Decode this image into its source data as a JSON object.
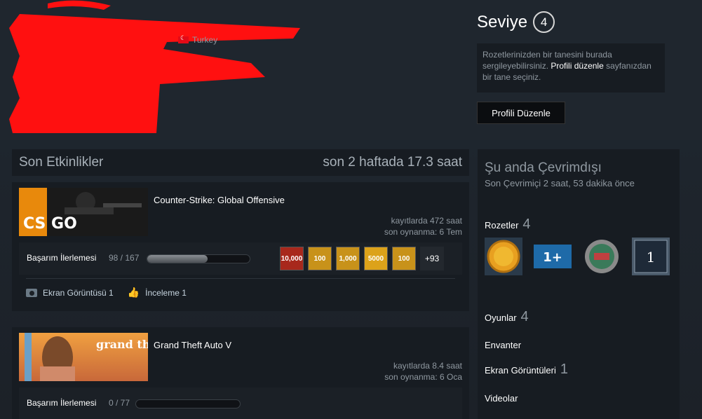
{
  "header": {
    "country": "Turkey",
    "level_label": "Seviye",
    "level_value": "4",
    "badge_hint_pre": "Rozetlerinizden bir tanesini burada sergileyebilirsiniz.",
    "badge_hint_link": "Profili düzenle",
    "badge_hint_post": "sayfanızdan bir tane seçiniz.",
    "edit_button": "Profili Düzenle"
  },
  "recent": {
    "title": "Son Etkinlikler",
    "hours": "son 2 haftada 17.3 saat",
    "games": [
      {
        "name": "Counter-Strike: Global Offensive",
        "hours_on_record": "kayıtlarda 472 saat",
        "last_played": "son oynanma: 6 Tem",
        "ach_label": "Başarım İlerlemesi",
        "ach_count": "98 / 167",
        "ach_progress": 0.587,
        "ach_icons": [
          "10,000",
          "100",
          "1,000",
          "5000",
          "100"
        ],
        "ach_more": "+93",
        "screenshot_label": "Ekran Görüntüsü 1",
        "review_label": "İnceleme 1",
        "capsule_text": "CS GO"
      },
      {
        "name": "Grand Theft Auto V",
        "hours_on_record": "kayıtlarda 8.4 saat",
        "last_played": "son oynanma: 6 Oca",
        "ach_label": "Başarım İlerlemesi",
        "ach_count": "0 / 77",
        "ach_progress": 0,
        "capsule_text": "grand theft auto"
      }
    ]
  },
  "sidebar": {
    "status_title": "Şu anda Çevrimdışı",
    "status_sub": "Son Çevrimiçi 2 saat, 53 dakika önce",
    "badges_label": "Rozetler",
    "badges_count": "4",
    "badge_one_text": "1+",
    "badge_four_text": "1",
    "games_label": "Oyunlar",
    "games_count": "4",
    "inventory_label": "Envanter",
    "screenshots_label": "Ekran Görüntüleri",
    "screenshots_count": "1",
    "videos_label": "Videolar"
  },
  "colors": {
    "accent": "#66c0f4",
    "redaction": "#ff0000"
  }
}
